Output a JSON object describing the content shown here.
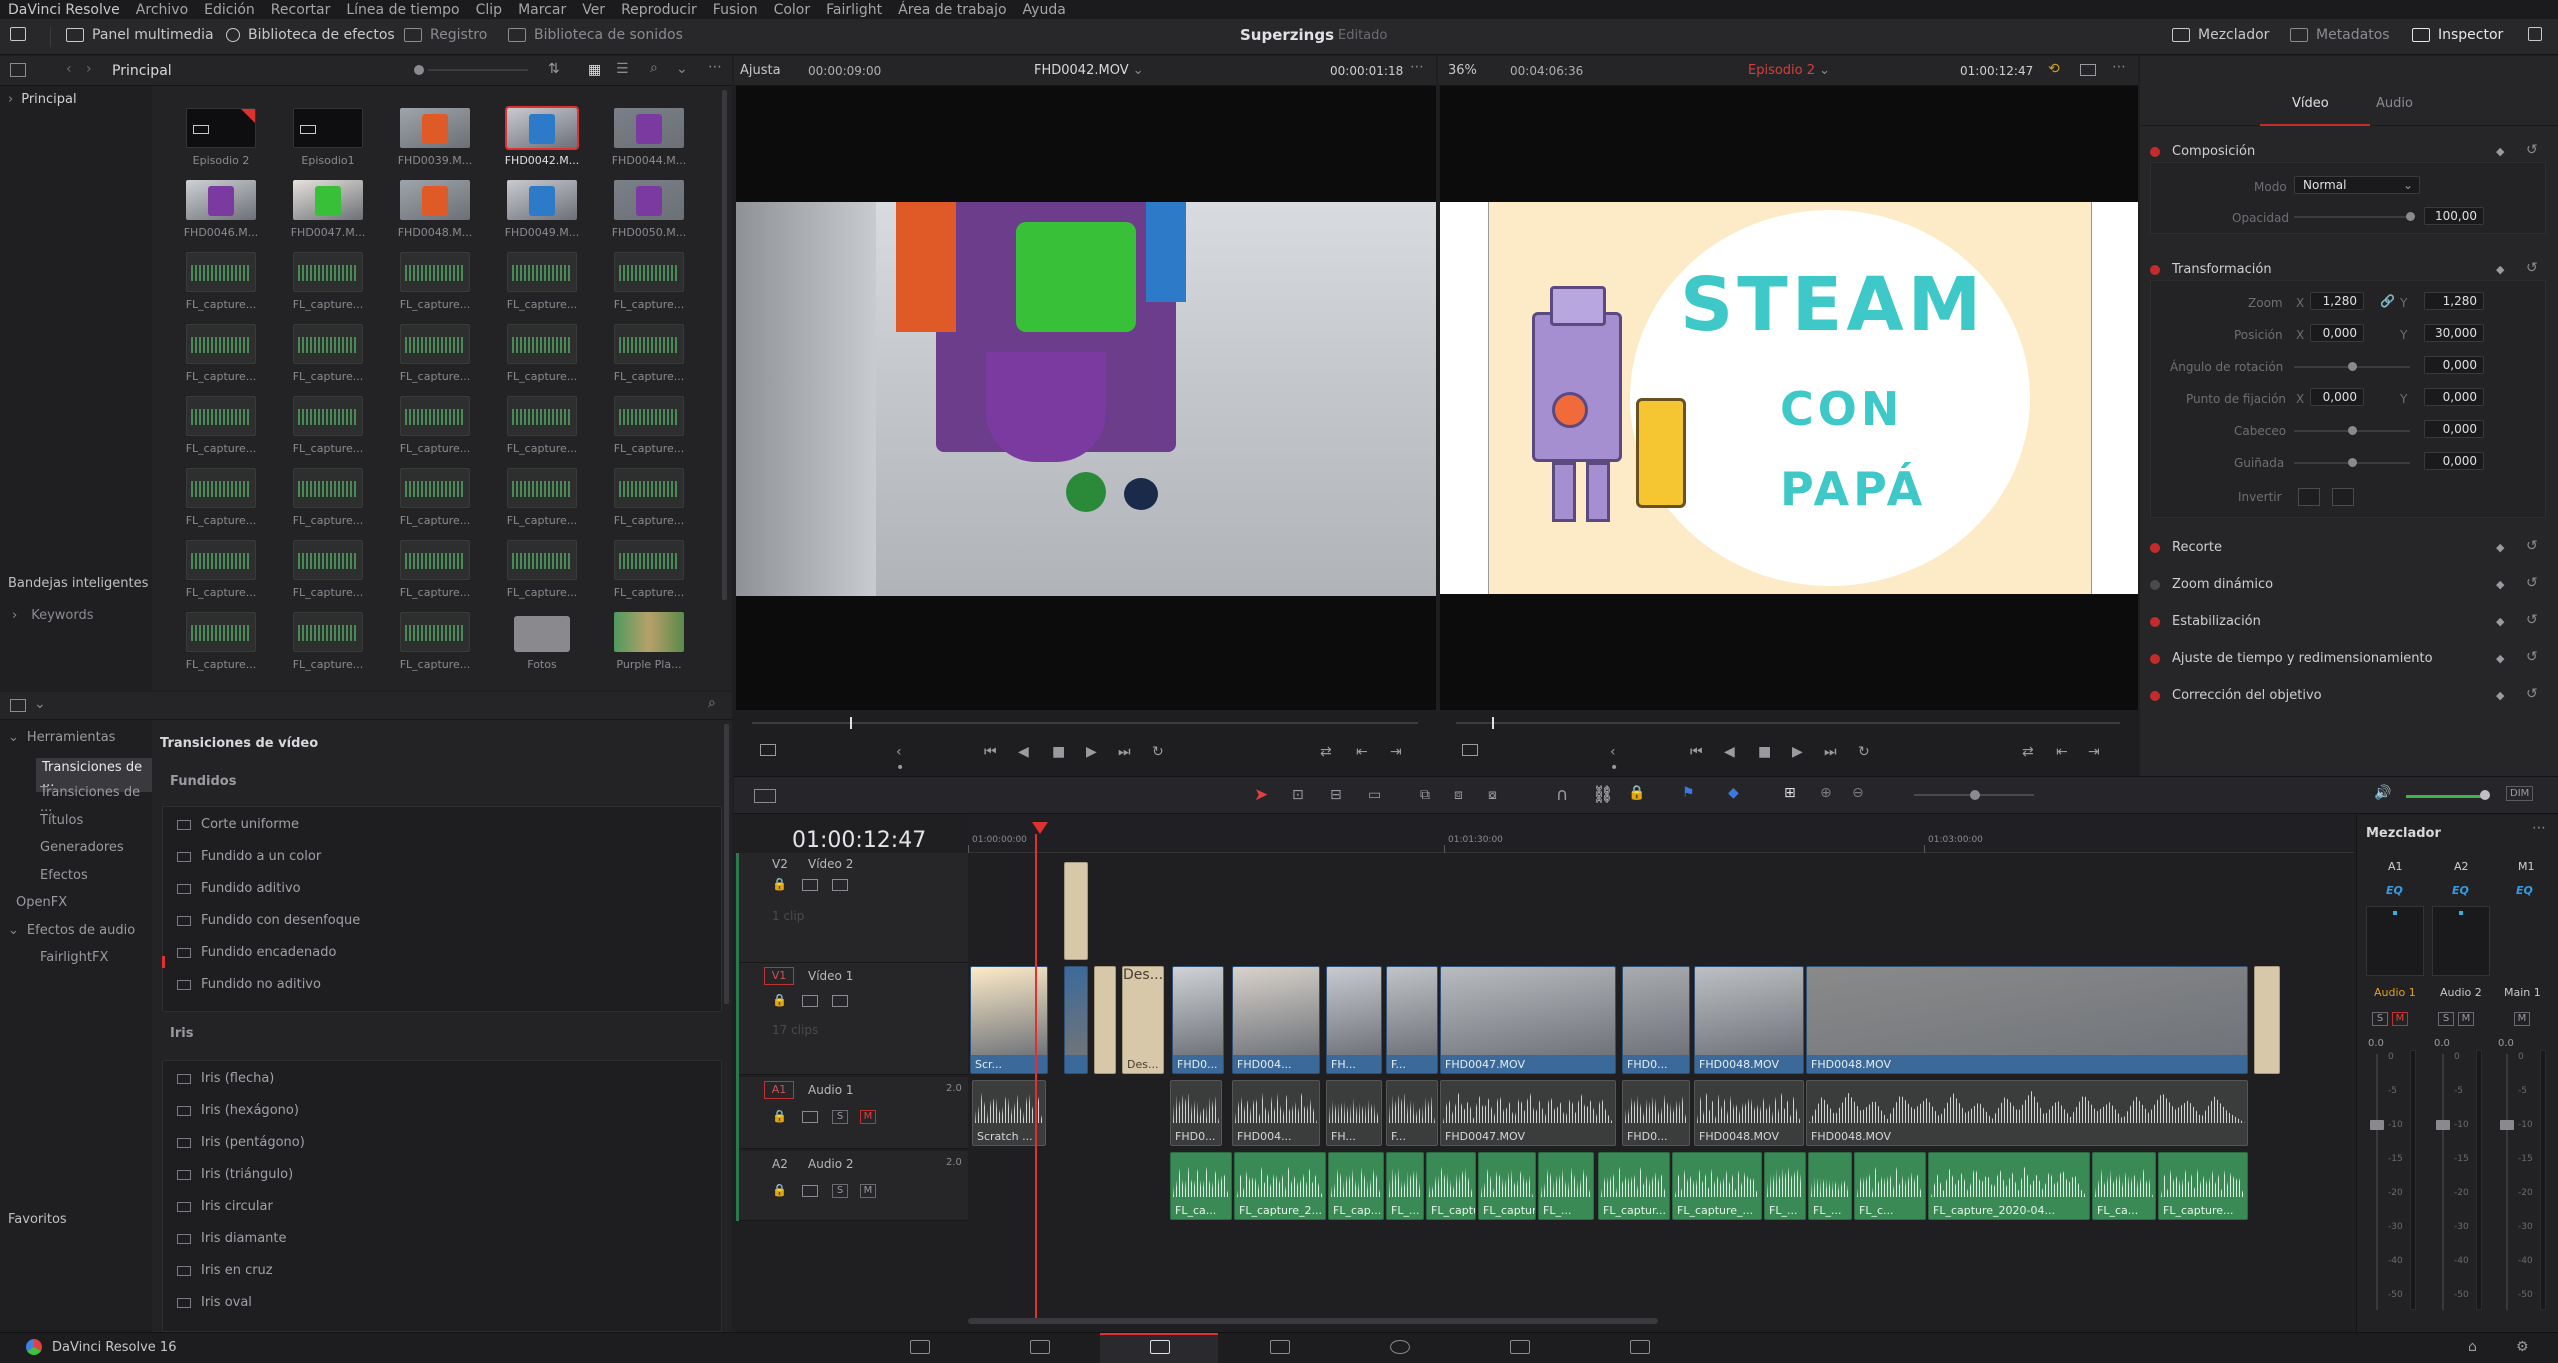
{
  "menu": [
    "DaVinci Resolve",
    "Archivo",
    "Edición",
    "Recortar",
    "Línea de tiempo",
    "Clip",
    "Marcar",
    "Ver",
    "Reproducir",
    "Fusion",
    "Color",
    "Fairlight",
    "Área de trabajo",
    "Ayuda"
  ],
  "toolbar": {
    "media_pool": "Panel multimedia",
    "effects_library": "Biblioteca de efectos",
    "edit_index": "Registro",
    "sound_library": "Biblioteca de sonidos",
    "mixer": "Mezclador",
    "metadata": "Metadatos",
    "inspector": "Inspector"
  },
  "project": {
    "title": "Superzings",
    "status": "Editado"
  },
  "media_pool": {
    "bin_title": "Principal",
    "tree_root": "Principal",
    "smart_bins": "Bandejas inteligentes",
    "keywords": "Keywords",
    "clips": [
      {
        "label": "Episodio 2",
        "kind": "timeline"
      },
      {
        "label": "Episodio1",
        "kind": "timeline"
      },
      {
        "label": "FHD0039.M...",
        "kind": "video"
      },
      {
        "label": "FHD0042.M...",
        "kind": "video",
        "selected": true
      },
      {
        "label": "FHD0044.M...",
        "kind": "video"
      },
      {
        "label": "FHD0046.M...",
        "kind": "video"
      },
      {
        "label": "FHD0047.M...",
        "kind": "video"
      },
      {
        "label": "FHD0048.M...",
        "kind": "video"
      },
      {
        "label": "FHD0049.M...",
        "kind": "video"
      },
      {
        "label": "FHD0050.M...",
        "kind": "video"
      },
      {
        "label": "FL_capture...",
        "kind": "audio"
      },
      {
        "label": "FL_capture...",
        "kind": "audio"
      },
      {
        "label": "FL_capture...",
        "kind": "audio"
      },
      {
        "label": "FL_capture...",
        "kind": "audio"
      },
      {
        "label": "FL_capture...",
        "kind": "audio"
      },
      {
        "label": "FL_capture...",
        "kind": "audio"
      },
      {
        "label": "FL_capture...",
        "kind": "audio"
      },
      {
        "label": "FL_capture...",
        "kind": "audio"
      },
      {
        "label": "FL_capture...",
        "kind": "audio"
      },
      {
        "label": "FL_capture...",
        "kind": "audio"
      },
      {
        "label": "FL_capture...",
        "kind": "audio"
      },
      {
        "label": "FL_capture...",
        "kind": "audio"
      },
      {
        "label": "FL_capture...",
        "kind": "audio"
      },
      {
        "label": "FL_capture...",
        "kind": "audio"
      },
      {
        "label": "FL_capture...",
        "kind": "audio"
      },
      {
        "label": "FL_capture...",
        "kind": "audio"
      },
      {
        "label": "FL_capture...",
        "kind": "audio"
      },
      {
        "label": "FL_capture...",
        "kind": "audio"
      },
      {
        "label": "FL_capture...",
        "kind": "audio"
      },
      {
        "label": "FL_capture...",
        "kind": "audio"
      },
      {
        "label": "FL_capture...",
        "kind": "audio"
      },
      {
        "label": "FL_capture...",
        "kind": "audio"
      },
      {
        "label": "FL_capture...",
        "kind": "audio"
      },
      {
        "label": "FL_capture...",
        "kind": "audio"
      },
      {
        "label": "FL_capture...",
        "kind": "audio"
      },
      {
        "label": "FL_capture...",
        "kind": "audio"
      },
      {
        "label": "FL_capture...",
        "kind": "audio"
      },
      {
        "label": "FL_capture...",
        "kind": "audio"
      },
      {
        "label": "Fotos",
        "kind": "folder"
      },
      {
        "label": "Purple Pla...",
        "kind": "image"
      }
    ]
  },
  "effects": {
    "tree": [
      {
        "label": "Herramientas",
        "level": 0,
        "expanded": true
      },
      {
        "label": "Transiciones de ...",
        "level": 1,
        "selected": true
      },
      {
        "label": "Transiciones de ...",
        "level": 1
      },
      {
        "label": "Títulos",
        "level": 1
      },
      {
        "label": "Generadores",
        "level": 1
      },
      {
        "label": "Efectos",
        "level": 1
      },
      {
        "label": "OpenFX",
        "level": 0
      },
      {
        "label": "Efectos de audio",
        "level": 0,
        "expanded": true
      },
      {
        "label": "FairlightFX",
        "level": 1
      }
    ],
    "favorites": "Favoritos",
    "section_title": "Transiciones de vídeo",
    "group1": "Fundidos",
    "group1_items": [
      "Corte uniforme",
      "Fundido a un color",
      "Fundido aditivo",
      "Fundido con desenfoque",
      "Fundido encadenado",
      "Fundido no aditivo"
    ],
    "group2": "Iris",
    "group2_items": [
      "Iris (flecha)",
      "Iris (hexágono)",
      "Iris (pentágono)",
      "Iris (triángulo)",
      "Iris circular",
      "Iris diamante",
      "Iris en cruz",
      "Iris oval"
    ]
  },
  "source_viewer": {
    "fit": "Ajusta",
    "duration": "00:00:09:00",
    "clip": "FHD0042.MOV",
    "timecode": "00:00:01:18"
  },
  "timeline_viewer": {
    "zoom": "36%",
    "duration": "00:04:06:36",
    "timeline": "Episodio 2",
    "timecode": "01:00:12:47"
  },
  "program": {
    "title_word1": "STEAM",
    "title_word2": "CON",
    "title_word3": "PAPÁ"
  },
  "inspector": {
    "tabs": [
      "Vídeo",
      "Audio"
    ],
    "sections": [
      {
        "name": "Composición",
        "on": true
      },
      {
        "name": "Transformación",
        "on": true
      },
      {
        "name": "Recorte",
        "on": true
      },
      {
        "name": "Zoom dinámico",
        "on": false
      },
      {
        "name": "Estabilización",
        "on": true
      },
      {
        "name": "Ajuste de tiempo y redimensionamiento",
        "on": true
      },
      {
        "name": "Corrección del objetivo",
        "on": true
      }
    ],
    "mode_label": "Modo",
    "mode_value": "Normal",
    "opacity_label": "Opacidad",
    "opacity_value": "100,00",
    "zoom_label": "Zoom",
    "zoom_x": "1,280",
    "zoom_y": "1,280",
    "position_label": "Posición",
    "pos_x": "0,000",
    "pos_y": "30,000",
    "rotation_label": "Ángulo de rotación",
    "rotation_value": "0,000",
    "anchor_label": "Punto de fijación",
    "anchor_x": "0,000",
    "anchor_y": "0,000",
    "pitch_label": "Cabeceo",
    "pitch_value": "0,000",
    "yaw_label": "Guiñada",
    "yaw_value": "0,000",
    "flip_label": "Invertir",
    "x": "X",
    "y": "Y"
  },
  "timeline": {
    "timecode": "01:00:12:47",
    "ruler": [
      "01:00:00:00",
      "01:01:30:00",
      "01:03:00:00"
    ],
    "tracks": {
      "v2": {
        "tag": "V2",
        "name": "Vídeo 2",
        "count": "1 clip"
      },
      "v1": {
        "tag": "V1",
        "name": "Vídeo 1",
        "count": "17 clips"
      },
      "a1": {
        "tag": "A1",
        "name": "Audio 1",
        "level": "2.0"
      },
      "a2": {
        "tag": "A2",
        "name": "Audio 2",
        "level": "2.0"
      }
    },
    "v1_clips": [
      "Scr...",
      "Des...",
      "FHD0...",
      "FHD004...",
      "FH...",
      "F...",
      "FHD0047.MOV",
      "FHD0...",
      "FHD0048.MOV",
      "FHD0048.MOV"
    ],
    "a1_clips": [
      "Scratch ...",
      "FHD0...",
      "FHD004...",
      "FH...",
      "F...",
      "FHD0047.MOV",
      "FHD0...",
      "FHD0048.MOV",
      "FHD0048.MOV"
    ],
    "a2_clips": [
      "FL_ca...",
      "FL_capture_2...",
      "FL_cap...",
      "FL_...",
      "FL_captu...",
      "FL_capture...",
      "FL_...",
      "FL_captur...",
      "FL_capture_...",
      "FL_...",
      "FL_...",
      "FL_c...",
      "FL_capture_2020-04...",
      "FL_ca...",
      "FL_capture..."
    ]
  },
  "mixer": {
    "title": "Mezclador",
    "channels": [
      "A1",
      "A2",
      "M1"
    ],
    "eq": "EQ",
    "strips": [
      "Audio 1",
      "Audio 2",
      "Main 1"
    ],
    "solo": "S",
    "mute": "M",
    "level": "0.0",
    "scale": [
      "0",
      "-5",
      "-10",
      "-15",
      "-20",
      "-30",
      "-40",
      "-50"
    ],
    "dim": "DIM"
  },
  "footer": {
    "app": "DaVinci Resolve 16"
  },
  "colors": {
    "accent": "#c52b2b",
    "playhead": "#e03030",
    "video_clip": "#3b6a9a",
    "audio2_clip": "#3a8a55"
  }
}
